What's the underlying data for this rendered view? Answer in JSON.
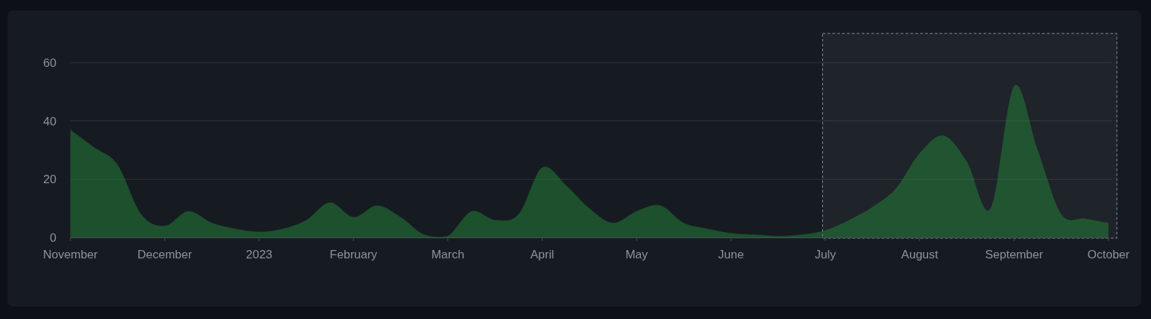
{
  "chart_data": {
    "type": "area",
    "categories": [
      "November",
      null,
      null,
      null,
      "December",
      null,
      null,
      null,
      "2023",
      null,
      null,
      null,
      "February",
      null,
      null,
      null,
      "March",
      null,
      null,
      null,
      "April",
      null,
      null,
      null,
      "May",
      null,
      null,
      null,
      "June",
      null,
      null,
      null,
      "July",
      null,
      null,
      null,
      "August",
      null,
      null,
      null,
      "September",
      null,
      null,
      null,
      "October"
    ],
    "series": [
      {
        "color": "#238636",
        "values": [
          37,
          31,
          25,
          8,
          4,
          9,
          5,
          3,
          2,
          3,
          6,
          12,
          7,
          11,
          7,
          1,
          0.5,
          9,
          6,
          8,
          24,
          18,
          10,
          5,
          9,
          11,
          5,
          3,
          1.5,
          1,
          0.5,
          1,
          2.5,
          6,
          10.5,
          17,
          29,
          35,
          26,
          10,
          52,
          30,
          8,
          6.5,
          5
        ]
      }
    ],
    "grid": true,
    "ylim": [
      0,
      60
    ],
    "yticks": [
      0,
      20,
      40,
      60
    ]
  }
}
